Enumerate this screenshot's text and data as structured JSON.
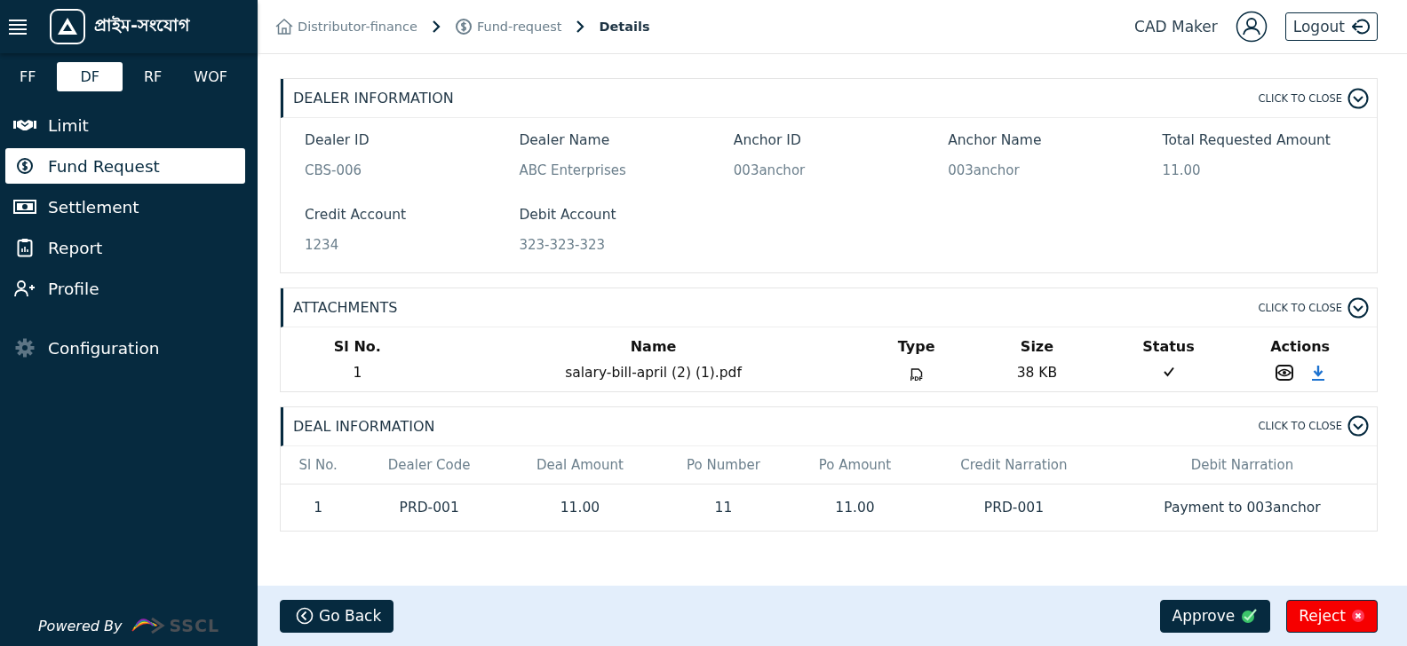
{
  "sidebar": {
    "brand": "প্রাইম-সংযোগ",
    "tabs": [
      {
        "label": "FF",
        "selected": false
      },
      {
        "label": "DF",
        "selected": true
      },
      {
        "label": "RF",
        "selected": false
      },
      {
        "label": "WOF",
        "selected": false
      }
    ],
    "items": [
      {
        "label": "Limit",
        "selected": false
      },
      {
        "label": "Fund Request",
        "selected": true
      },
      {
        "label": "Settlement",
        "selected": false
      },
      {
        "label": "Report",
        "selected": false
      },
      {
        "label": "Profile",
        "selected": false
      }
    ],
    "settings_items": [
      {
        "label": "Configuration",
        "selected": false
      }
    ],
    "footer": {
      "text": "Powered By",
      "logo_text": "SSCL"
    }
  },
  "breadcrumb": [
    {
      "label": "Distributor-finance"
    },
    {
      "label": "Fund-request"
    },
    {
      "label": "Details"
    }
  ],
  "user": {
    "name": "CAD Maker",
    "logout": "Logout"
  },
  "dealer_section": {
    "title": "DEALER INFORMATION",
    "toggle": "CLICK TO CLOSE",
    "expanded": true,
    "fields": [
      {
        "label": "Dealer ID",
        "value": "CBS-006"
      },
      {
        "label": "Dealer Name",
        "value": "ABC Enterprises"
      },
      {
        "label": "Anchor ID",
        "value": "003anchor"
      },
      {
        "label": "Anchor Name",
        "value": "003anchor"
      },
      {
        "label": "Total Requested Amount",
        "value": "11.00"
      },
      {
        "label": "Credit Account",
        "value": "1234"
      },
      {
        "label": "Debit Account",
        "value": "323-323-323"
      }
    ]
  },
  "attachments_section": {
    "title": "ATTACHMENTS",
    "toggle": "CLICK TO CLOSE",
    "expanded": true,
    "columns": [
      "Sl No.",
      "Name",
      "Type",
      "Size",
      "Status",
      "Actions"
    ],
    "rows": [
      {
        "sl": "1",
        "name": "salary-bill-april (2) (1).pdf",
        "type": "PDF",
        "size": "38 KB",
        "verified": true
      }
    ]
  },
  "deal_section": {
    "title": "DEAL INFORMATION",
    "toggle": "CLICK TO CLOSE",
    "expanded": true,
    "columns": [
      "Sl No.",
      "Dealer Code",
      "Deal Amount",
      "Po Number",
      "Po Amount",
      "Credit Narration",
      "Debit Narration"
    ],
    "rows": [
      [
        "1",
        "PRD-001",
        "11.00",
        "11",
        "11.00",
        "PRD-001",
        "Payment to 003anchor"
      ]
    ]
  },
  "footer": {
    "back": "Go Back",
    "approve": "Approve",
    "reject": "Reject"
  }
}
